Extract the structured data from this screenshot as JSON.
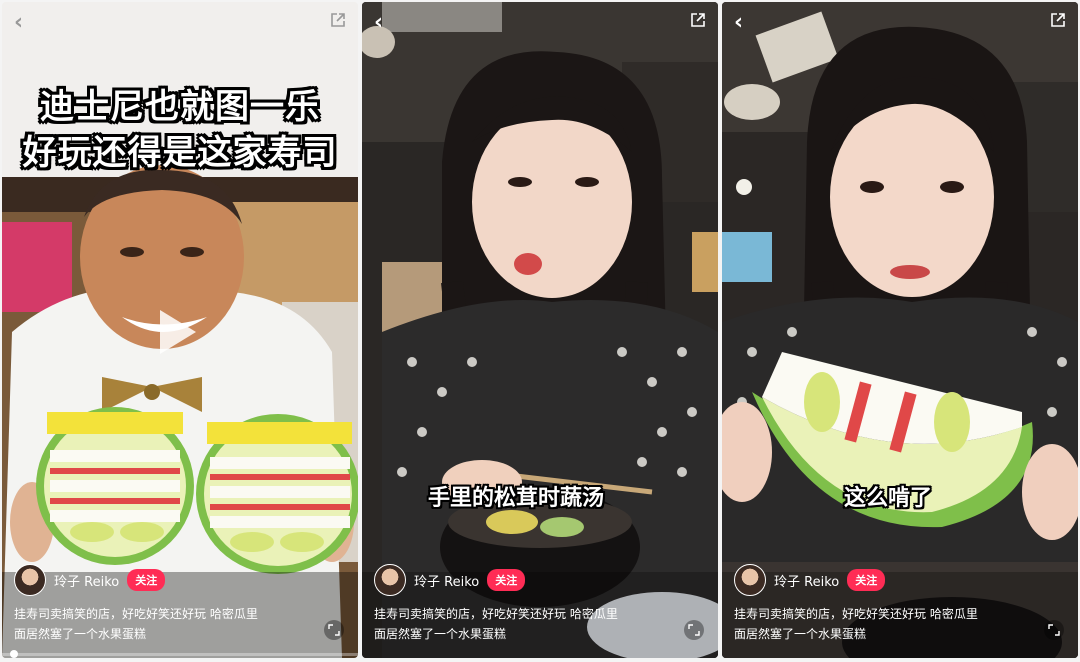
{
  "panels": [
    {
      "title_lines": [
        "迪士尼也就图一乐",
        "好玩还得是这家寿司"
      ],
      "author": "玲子 Reiko",
      "follow_label": "关注",
      "description_line1": "挂寿司卖搞笑的店，好吃好笑还好玩 哈密瓜里",
      "description_line2": "面居然塞了一个水果蛋糕",
      "icons": {
        "back": "back-icon",
        "share": "share-icon",
        "play": "play-icon",
        "fullscreen": "fullscreen-icon"
      }
    },
    {
      "subtitle": "手里的松茸时蔬汤",
      "author": "玲子 Reiko",
      "follow_label": "关注",
      "description_line1": "挂寿司卖搞笑的店，好吃好笑还好玩 哈密瓜里",
      "description_line2": "面居然塞了一个水果蛋糕"
    },
    {
      "subtitle": "这么啃了",
      "author": "玲子 Reiko",
      "follow_label": "关注",
      "description_line1": "挂寿司卖搞笑的店，好吃好笑还好玩 哈密瓜里",
      "description_line2": "面居然塞了一个水果蛋糕"
    }
  ],
  "colors": {
    "follow": "#ff2c55",
    "melon_rind": "#7fbf4a",
    "melon_flesh": "#eaf2b8",
    "cream": "#fbfaf3",
    "strawberry": "#e04848"
  }
}
